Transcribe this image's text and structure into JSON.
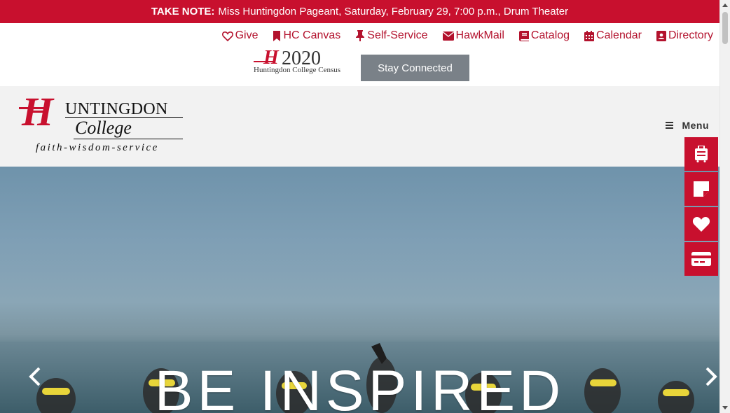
{
  "notice": {
    "label": "TAKE NOTE:",
    "text": "Miss Huntingdon Pageant, Saturday, February 29, 7:00 p.m., Drum Theater",
    "color": "#c8102e"
  },
  "util_nav": [
    {
      "label": "Give",
      "icon": "heart-outline-icon"
    },
    {
      "label": "HC Canvas",
      "icon": "bookmark-icon"
    },
    {
      "label": "Self-Service",
      "icon": "pushpin-icon"
    },
    {
      "label": "HawkMail",
      "icon": "envelope-icon"
    },
    {
      "label": "Catalog",
      "icon": "book-icon"
    },
    {
      "label": "Calendar",
      "icon": "calendar-icon"
    },
    {
      "label": "Directory",
      "icon": "address-book-icon"
    }
  ],
  "census": {
    "logo_h": "H",
    "logo_year": "2020",
    "logo_sub": "Huntingdon College Census",
    "button": "Stay Connected"
  },
  "header": {
    "logo": {
      "h": "H",
      "untingdon": "UNTINGDON",
      "college": "College",
      "tagline": "faith-wisdom-service"
    },
    "menu_label": "Menu"
  },
  "hero": {
    "title": "BE INSPIRED"
  },
  "quick_links": [
    {
      "icon": "luggage-icon"
    },
    {
      "icon": "sticky-note-icon"
    },
    {
      "icon": "heart-icon"
    },
    {
      "icon": "credit-card-icon"
    }
  ],
  "colors": {
    "brand_red": "#c8102e",
    "link_red": "#b3122d",
    "button_gray": "#7a8188",
    "header_bg": "#f2f2f2"
  }
}
